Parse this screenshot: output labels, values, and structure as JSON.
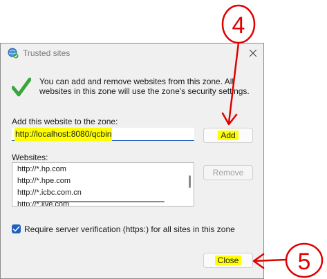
{
  "window": {
    "title": "Trusted sites"
  },
  "info": {
    "text": "You can add and remove websites from this zone. All websites in this zone will use the zone's security settings."
  },
  "add_site": {
    "label": "Add this website to the zone:",
    "value": "http://localhost:8080/qcbin",
    "button_label": "Add"
  },
  "websites": {
    "label": "Websites:",
    "items": [
      "http://*.hp.com",
      "http://*.hpe.com",
      "http://*.icbc.com.cn",
      "http://*.live.com"
    ],
    "remove_label": "Remove"
  },
  "verification": {
    "label": "Require server verification (https:) for all sites in this zone",
    "checked": true
  },
  "footer": {
    "close_label": "Close"
  },
  "annotations": {
    "step_a": "4",
    "step_b": "5",
    "color": "#e00000"
  },
  "colors": {
    "highlight": "#ffff00",
    "accent": "#1f5fbf",
    "annotation": "#e00000"
  }
}
